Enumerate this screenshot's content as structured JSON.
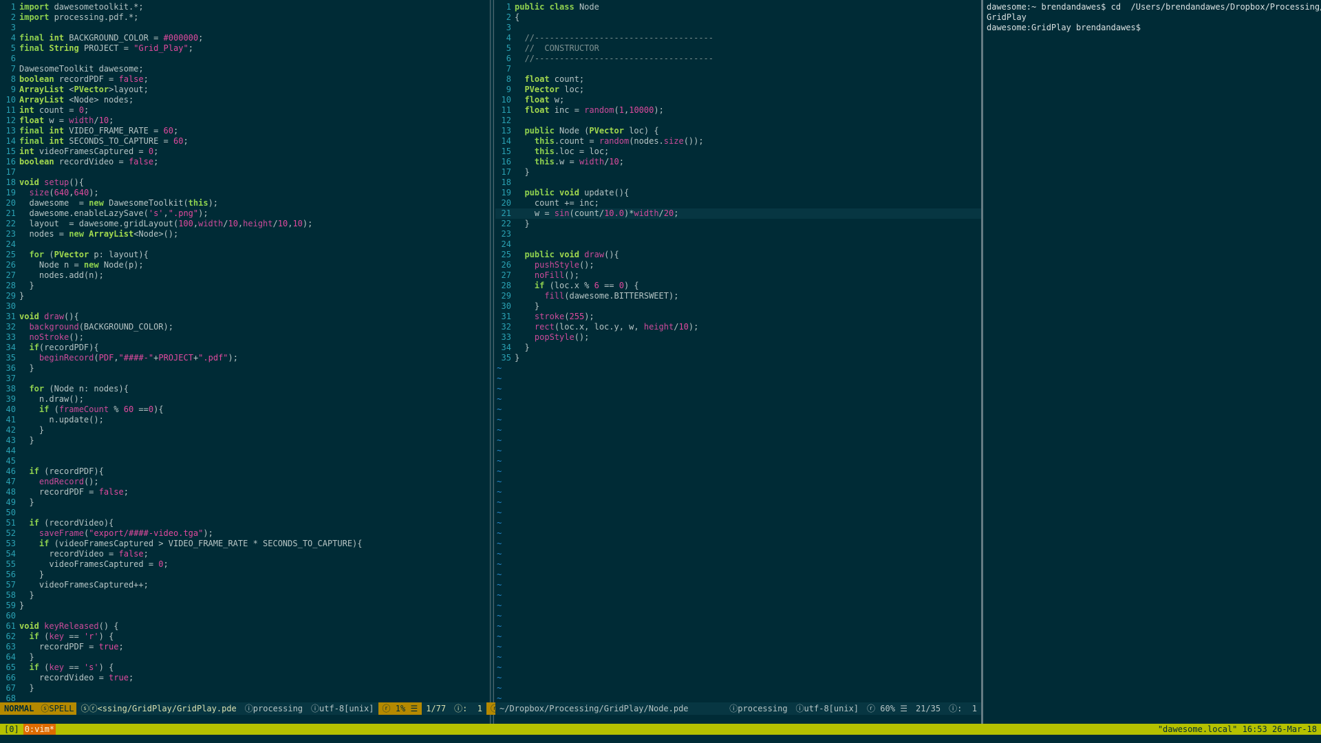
{
  "left_editor": {
    "lines": [
      [
        [
          "k",
          "import"
        ],
        [
          "tx",
          " dawesometoolkit.*;"
        ]
      ],
      [
        [
          "k",
          "import"
        ],
        [
          "tx",
          " processing.pdf.*;"
        ]
      ],
      [],
      [
        [
          "k",
          "final"
        ],
        [
          "tx",
          " "
        ],
        [
          "t",
          "int"
        ],
        [
          "tx",
          " BACKGROUND_COLOR = "
        ],
        [
          "n",
          "#000000"
        ],
        [
          "tx",
          ";"
        ]
      ],
      [
        [
          "k",
          "final"
        ],
        [
          "tx",
          " "
        ],
        [
          "t",
          "String"
        ],
        [
          "tx",
          " PROJECT = "
        ],
        [
          "s",
          "\"Grid_Play\""
        ],
        [
          "tx",
          ";"
        ]
      ],
      [],
      [
        [
          "tx",
          "DawesomeToolkit dawesome;"
        ]
      ],
      [
        [
          "t",
          "boolean"
        ],
        [
          "tx",
          " recordPDF = "
        ],
        [
          "s",
          "false"
        ],
        [
          "tx",
          ";"
        ]
      ],
      [
        [
          "t",
          "ArrayList"
        ],
        [
          "tx",
          " <"
        ],
        [
          "t",
          "PVector"
        ],
        [
          "tx",
          ">layout;"
        ]
      ],
      [
        [
          "t",
          "ArrayList"
        ],
        [
          "tx",
          " <Node> nodes;"
        ]
      ],
      [
        [
          "t",
          "int"
        ],
        [
          "tx",
          " count = "
        ],
        [
          "n",
          "0"
        ],
        [
          "tx",
          ";"
        ]
      ],
      [
        [
          "t",
          "float"
        ],
        [
          "tx",
          " w = "
        ],
        [
          "f",
          "width"
        ],
        [
          "tx",
          "/"
        ],
        [
          "n",
          "10"
        ],
        [
          "tx",
          ";"
        ]
      ],
      [
        [
          "k",
          "final"
        ],
        [
          "tx",
          " "
        ],
        [
          "t",
          "int"
        ],
        [
          "tx",
          " VIDEO_FRAME_RATE = "
        ],
        [
          "n",
          "60"
        ],
        [
          "tx",
          ";"
        ]
      ],
      [
        [
          "k",
          "final"
        ],
        [
          "tx",
          " "
        ],
        [
          "t",
          "int"
        ],
        [
          "tx",
          " SECONDS_TO_CAPTURE = "
        ],
        [
          "n",
          "60"
        ],
        [
          "tx",
          ";"
        ]
      ],
      [
        [
          "t",
          "int"
        ],
        [
          "tx",
          " videoFramesCaptured = "
        ],
        [
          "n",
          "0"
        ],
        [
          "tx",
          ";"
        ]
      ],
      [
        [
          "t",
          "boolean"
        ],
        [
          "tx",
          " recordVideo = "
        ],
        [
          "s",
          "false"
        ],
        [
          "tx",
          ";"
        ]
      ],
      [],
      [
        [
          "t",
          "void"
        ],
        [
          "tx",
          " "
        ],
        [
          "f",
          "setup"
        ],
        [
          "tx",
          "(){"
        ]
      ],
      [
        [
          "tx",
          "  "
        ],
        [
          "f",
          "size"
        ],
        [
          "tx",
          "("
        ],
        [
          "n",
          "640"
        ],
        [
          "tx",
          ","
        ],
        [
          "n",
          "640"
        ],
        [
          "tx",
          ");"
        ]
      ],
      [
        [
          "tx",
          "  dawesome  = "
        ],
        [
          "k",
          "new"
        ],
        [
          "tx",
          " DawesomeToolkit("
        ],
        [
          "k",
          "this"
        ],
        [
          "tx",
          ");"
        ]
      ],
      [
        [
          "tx",
          "  dawesome.enableLazySave("
        ],
        [
          "s",
          "'s'"
        ],
        [
          "tx",
          ","
        ],
        [
          "s",
          "\".png\""
        ],
        [
          "tx",
          ");"
        ]
      ],
      [
        [
          "tx",
          "  layout  = dawesome.gridLayout("
        ],
        [
          "n",
          "100"
        ],
        [
          "tx",
          ","
        ],
        [
          "f",
          "width"
        ],
        [
          "tx",
          "/"
        ],
        [
          "n",
          "10"
        ],
        [
          "tx",
          ","
        ],
        [
          "f",
          "height"
        ],
        [
          "tx",
          "/"
        ],
        [
          "n",
          "10"
        ],
        [
          "tx",
          ","
        ],
        [
          "n",
          "10"
        ],
        [
          "tx",
          ");"
        ]
      ],
      [
        [
          "tx",
          "  nodes = "
        ],
        [
          "k",
          "new"
        ],
        [
          "tx",
          " "
        ],
        [
          "t",
          "ArrayList"
        ],
        [
          "tx",
          "<Node>();"
        ]
      ],
      [],
      [
        [
          "tx",
          "  "
        ],
        [
          "k",
          "for"
        ],
        [
          "tx",
          " ("
        ],
        [
          "t",
          "PVector"
        ],
        [
          "tx",
          " p: layout){"
        ]
      ],
      [
        [
          "tx",
          "    Node n = "
        ],
        [
          "k",
          "new"
        ],
        [
          "tx",
          " Node(p);"
        ]
      ],
      [
        [
          "tx",
          "    nodes.add(n);"
        ]
      ],
      [
        [
          "tx",
          "  }"
        ]
      ],
      [
        [
          "tx",
          "}"
        ]
      ],
      [],
      [
        [
          "t",
          "void"
        ],
        [
          "tx",
          " "
        ],
        [
          "f",
          "draw"
        ],
        [
          "tx",
          "(){"
        ]
      ],
      [
        [
          "tx",
          "  "
        ],
        [
          "f",
          "background"
        ],
        [
          "tx",
          "(BACKGROUND_COLOR);"
        ]
      ],
      [
        [
          "tx",
          "  "
        ],
        [
          "f",
          "noStroke"
        ],
        [
          "tx",
          "();"
        ]
      ],
      [
        [
          "tx",
          "  "
        ],
        [
          "k",
          "if"
        ],
        [
          "tx",
          "(recordPDF){"
        ]
      ],
      [
        [
          "tx",
          "    "
        ],
        [
          "f",
          "beginRecord"
        ],
        [
          "tx",
          "("
        ],
        [
          "s",
          "PDF"
        ],
        [
          "tx",
          ","
        ],
        [
          "s",
          "\"####-\""
        ],
        [
          "tx",
          "+"
        ],
        [
          "s",
          "PROJECT"
        ],
        [
          "tx",
          "+"
        ],
        [
          "s",
          "\".pdf\""
        ],
        [
          "tx",
          ");"
        ]
      ],
      [
        [
          "tx",
          "  }"
        ]
      ],
      [],
      [
        [
          "tx",
          "  "
        ],
        [
          "k",
          "for"
        ],
        [
          "tx",
          " (Node n: nodes){"
        ]
      ],
      [
        [
          "tx",
          "    n.draw();"
        ]
      ],
      [
        [
          "tx",
          "    "
        ],
        [
          "k",
          "if"
        ],
        [
          "tx",
          " ("
        ],
        [
          "f",
          "frameCount"
        ],
        [
          "tx",
          " % "
        ],
        [
          "n",
          "60"
        ],
        [
          "tx",
          " =="
        ],
        [
          "n",
          "0"
        ],
        [
          "tx",
          "){"
        ]
      ],
      [
        [
          "tx",
          "      n.update();"
        ]
      ],
      [
        [
          "tx",
          "    }"
        ]
      ],
      [
        [
          "tx",
          "  }"
        ]
      ],
      [],
      [],
      [
        [
          "tx",
          "  "
        ],
        [
          "k",
          "if"
        ],
        [
          "tx",
          " (recordPDF){"
        ]
      ],
      [
        [
          "tx",
          "    "
        ],
        [
          "f",
          "endRecord"
        ],
        [
          "tx",
          "();"
        ]
      ],
      [
        [
          "tx",
          "    recordPDF = "
        ],
        [
          "s",
          "false"
        ],
        [
          "tx",
          ";"
        ]
      ],
      [
        [
          "tx",
          "  }"
        ]
      ],
      [],
      [
        [
          "tx",
          "  "
        ],
        [
          "k",
          "if"
        ],
        [
          "tx",
          " (recordVideo){"
        ]
      ],
      [
        [
          "tx",
          "    "
        ],
        [
          "f",
          "saveFrame"
        ],
        [
          "tx",
          "("
        ],
        [
          "s",
          "\"export/####-video.tga\""
        ],
        [
          "tx",
          ");"
        ]
      ],
      [
        [
          "tx",
          "    "
        ],
        [
          "k",
          "if"
        ],
        [
          "tx",
          " (videoFramesCaptured > VIDEO_FRAME_RATE * SECONDS_TO_CAPTURE){"
        ]
      ],
      [
        [
          "tx",
          "      recordVideo = "
        ],
        [
          "s",
          "false"
        ],
        [
          "tx",
          ";"
        ]
      ],
      [
        [
          "tx",
          "      videoFramesCaptured = "
        ],
        [
          "n",
          "0"
        ],
        [
          "tx",
          ";"
        ]
      ],
      [
        [
          "tx",
          "    }"
        ]
      ],
      [
        [
          "tx",
          "    videoFramesCaptured++;"
        ]
      ],
      [
        [
          "tx",
          "  }"
        ]
      ],
      [
        [
          "tx",
          "}"
        ]
      ],
      [],
      [
        [
          "t",
          "void"
        ],
        [
          "tx",
          " "
        ],
        [
          "f",
          "keyReleased"
        ],
        [
          "tx",
          "() {"
        ]
      ],
      [
        [
          "tx",
          "  "
        ],
        [
          "k",
          "if"
        ],
        [
          "tx",
          " ("
        ],
        [
          "f",
          "key"
        ],
        [
          "tx",
          " == "
        ],
        [
          "s",
          "'r'"
        ],
        [
          "tx",
          ") {"
        ]
      ],
      [
        [
          "tx",
          "    recordPDF = "
        ],
        [
          "s",
          "true"
        ],
        [
          "tx",
          ";"
        ]
      ],
      [
        [
          "tx",
          "  }"
        ]
      ],
      [
        [
          "tx",
          "  "
        ],
        [
          "k",
          "if"
        ],
        [
          "tx",
          " ("
        ],
        [
          "f",
          "key"
        ],
        [
          "tx",
          " == "
        ],
        [
          "s",
          "'s'"
        ],
        [
          "tx",
          ") {"
        ]
      ],
      [
        [
          "tx",
          "    recordVideo = "
        ],
        [
          "s",
          "true"
        ],
        [
          "tx",
          ";"
        ]
      ],
      [
        [
          "tx",
          "  }"
        ]
      ],
      []
    ],
    "status": {
      "mode": "NORMAL",
      "spell": "ⓢSPELL",
      "file": "ⓢⓡ<ssing/GridPlay/GridPlay.pde",
      "filetype": "ⓘprocessing",
      "encoding": "ⓘutf-8[unix]",
      "marker": "ⓡ",
      "percent": "1%",
      "lines_icon": "☰",
      "position": "1/77",
      "col": "ⓘ:  1",
      "end_marker": "ⓡ"
    }
  },
  "right_editor": {
    "current_line": 21,
    "lines": [
      [
        [
          "k",
          "public"
        ],
        [
          "tx",
          " "
        ],
        [
          "k",
          "class"
        ],
        [
          "tx",
          " Node"
        ]
      ],
      [
        [
          "tx",
          "{"
        ]
      ],
      [],
      [
        [
          "tx",
          "  "
        ],
        [
          "c",
          "//------------------------------------"
        ]
      ],
      [
        [
          "tx",
          "  "
        ],
        [
          "c",
          "//  CONSTRUCTOR"
        ]
      ],
      [
        [
          "tx",
          "  "
        ],
        [
          "c",
          "//------------------------------------"
        ]
      ],
      [],
      [
        [
          "tx",
          "  "
        ],
        [
          "t",
          "float"
        ],
        [
          "tx",
          " count;"
        ]
      ],
      [
        [
          "tx",
          "  "
        ],
        [
          "t",
          "PVector"
        ],
        [
          "tx",
          " loc;"
        ]
      ],
      [
        [
          "tx",
          "  "
        ],
        [
          "t",
          "float"
        ],
        [
          "tx",
          " w;"
        ]
      ],
      [
        [
          "tx",
          "  "
        ],
        [
          "t",
          "float"
        ],
        [
          "tx",
          " inc = "
        ],
        [
          "f",
          "random"
        ],
        [
          "tx",
          "("
        ],
        [
          "n",
          "1"
        ],
        [
          "tx",
          ","
        ],
        [
          "n",
          "10000"
        ],
        [
          "tx",
          ");"
        ]
      ],
      [],
      [
        [
          "tx",
          "  "
        ],
        [
          "k",
          "public"
        ],
        [
          "tx",
          " Node ("
        ],
        [
          "t",
          "PVector"
        ],
        [
          "tx",
          " loc) {"
        ]
      ],
      [
        [
          "tx",
          "    "
        ],
        [
          "k",
          "this"
        ],
        [
          "tx",
          ".count = "
        ],
        [
          "f",
          "random"
        ],
        [
          "tx",
          "(nodes."
        ],
        [
          "f",
          "size"
        ],
        [
          "tx",
          "());"
        ]
      ],
      [
        [
          "tx",
          "    "
        ],
        [
          "k",
          "this"
        ],
        [
          "tx",
          ".loc = loc;"
        ]
      ],
      [
        [
          "tx",
          "    "
        ],
        [
          "k",
          "this"
        ],
        [
          "tx",
          ".w = "
        ],
        [
          "f",
          "width"
        ],
        [
          "tx",
          "/"
        ],
        [
          "n",
          "10"
        ],
        [
          "tx",
          ";"
        ]
      ],
      [
        [
          "tx",
          "  }"
        ]
      ],
      [],
      [
        [
          "tx",
          "  "
        ],
        [
          "k",
          "public"
        ],
        [
          "tx",
          " "
        ],
        [
          "t",
          "void"
        ],
        [
          "tx",
          " update(){"
        ]
      ],
      [
        [
          "tx",
          "    count += inc;"
        ]
      ],
      [
        [
          "tx",
          "    w = "
        ],
        [
          "f",
          "sin"
        ],
        [
          "tx",
          "(count/"
        ],
        [
          "n",
          "10.0"
        ],
        [
          "tx",
          ")*"
        ],
        [
          "f",
          "width"
        ],
        [
          "tx",
          "/"
        ],
        [
          "n",
          "20"
        ],
        [
          "tx",
          ";"
        ]
      ],
      [
        [
          "tx",
          "  }"
        ]
      ],
      [],
      [],
      [
        [
          "tx",
          "  "
        ],
        [
          "k",
          "public"
        ],
        [
          "tx",
          " "
        ],
        [
          "t",
          "void"
        ],
        [
          "tx",
          " "
        ],
        [
          "f",
          "draw"
        ],
        [
          "tx",
          "(){"
        ]
      ],
      [
        [
          "tx",
          "    "
        ],
        [
          "f",
          "pushStyle"
        ],
        [
          "tx",
          "();"
        ]
      ],
      [
        [
          "tx",
          "    "
        ],
        [
          "f",
          "noFill"
        ],
        [
          "tx",
          "();"
        ]
      ],
      [
        [
          "tx",
          "    "
        ],
        [
          "k",
          "if"
        ],
        [
          "tx",
          " (loc.x % "
        ],
        [
          "n",
          "6"
        ],
        [
          "tx",
          " == "
        ],
        [
          "n",
          "0"
        ],
        [
          "tx",
          ") {"
        ]
      ],
      [
        [
          "tx",
          "      "
        ],
        [
          "f",
          "fill"
        ],
        [
          "tx",
          "(dawesome.BITTERSWEET);"
        ]
      ],
      [
        [
          "tx",
          "    }"
        ]
      ],
      [
        [
          "tx",
          "    "
        ],
        [
          "f",
          "stroke"
        ],
        [
          "tx",
          "("
        ],
        [
          "n",
          "255"
        ],
        [
          "tx",
          ");"
        ]
      ],
      [
        [
          "tx",
          "    "
        ],
        [
          "f",
          "rect"
        ],
        [
          "tx",
          "(loc.x, loc.y, w, "
        ],
        [
          "f",
          "height"
        ],
        [
          "tx",
          "/"
        ],
        [
          "n",
          "10"
        ],
        [
          "tx",
          ");"
        ]
      ],
      [
        [
          "tx",
          "    "
        ],
        [
          "f",
          "popStyle"
        ],
        [
          "tx",
          "();"
        ]
      ],
      [
        [
          "tx",
          "  }"
        ]
      ],
      [
        [
          "tx",
          "}"
        ]
      ]
    ],
    "tilde_rows": 33,
    "status": {
      "file": "~/Dropbox/Processing/GridPlay/Node.pde",
      "filetype": "ⓘprocessing",
      "encoding": "ⓘutf-8[unix]",
      "marker": "ⓡ",
      "percent": "60%",
      "lines_icon": "☰",
      "position": "21/35",
      "col": "ⓘ:  1"
    }
  },
  "terminal": {
    "lines": [
      "dawesome:~ brendandawes$ cd  /Users/brendandawes/Dropbox/Processing/",
      "GridPlay",
      "dawesome:GridPlay brendandawes$"
    ]
  },
  "tmux": {
    "session": "[0]",
    "window": "0:vim*",
    "right": "\"dawesome.local\" 16:53 26-Mar-18"
  }
}
